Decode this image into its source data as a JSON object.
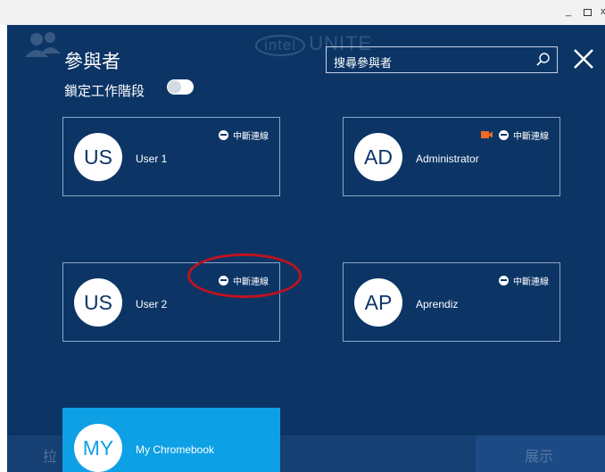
{
  "window": {
    "minimize_glyph": "_",
    "close_glyph": "x"
  },
  "background": {
    "logo_brand": "intel",
    "logo_text": "UNITE"
  },
  "header": {
    "title": "參與者",
    "lock_stage_label": "鎖定工作階段",
    "lock_stage_on": false,
    "search_placeholder": "搜尋參與者"
  },
  "participants": [
    {
      "initials": "US",
      "name": "User 1",
      "disconnect_label": "中斷連線",
      "camera": false,
      "highlighted": false
    },
    {
      "initials": "AD",
      "name": "Administrator",
      "disconnect_label": "中斷連線",
      "camera": true,
      "highlighted": false
    },
    {
      "initials": "US",
      "name": "User 2",
      "disconnect_label": "中斷連線",
      "camera": false,
      "highlighted": true
    },
    {
      "initials": "AP",
      "name": "Aprendiz",
      "disconnect_label": "中斷連線",
      "camera": false,
      "highlighted": false
    },
    {
      "initials": "MY",
      "name": "My Chromebook",
      "self": true
    }
  ],
  "bottom_bar": {
    "left_label": "拉",
    "right_label": "展示"
  },
  "colors": {
    "background": "#0c3566",
    "active_card": "#0ea0e5",
    "camera": "#f26a21",
    "annotation": "#c0121e"
  }
}
